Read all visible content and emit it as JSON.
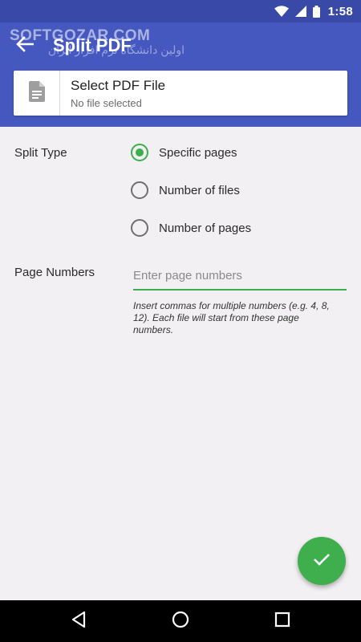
{
  "status_bar": {
    "time": "1:58",
    "icons": [
      "wifi-icon",
      "cell-signal-icon",
      "battery-icon"
    ]
  },
  "watermark": {
    "text": "SOFTGOZAR.COM",
    "subtext": "اولین دانشگاه نرم افزار ایران"
  },
  "app_bar": {
    "title": "Split PDF",
    "back_icon": "arrow-back-icon",
    "color": "#4458bf"
  },
  "file_card": {
    "title": "Select PDF File",
    "subtitle": "No file selected",
    "icon": "document-icon"
  },
  "split_type": {
    "label": "Split Type",
    "options": [
      {
        "label": "Specific pages",
        "checked": true
      },
      {
        "label": "Number of files",
        "checked": false
      },
      {
        "label": "Number of pages",
        "checked": false
      }
    ]
  },
  "page_numbers": {
    "label": "Page Numbers",
    "placeholder": "Enter page numbers",
    "value": "",
    "hint": "Insert commas for multiple numbers (e.g. 4, 8, 12). Each file will start from these page numbers."
  },
  "fab": {
    "icon": "check-icon",
    "color": "#3fae4d"
  },
  "nav_bar": {
    "icons": [
      "nav-back-icon",
      "nav-home-icon",
      "nav-recents-icon"
    ]
  }
}
